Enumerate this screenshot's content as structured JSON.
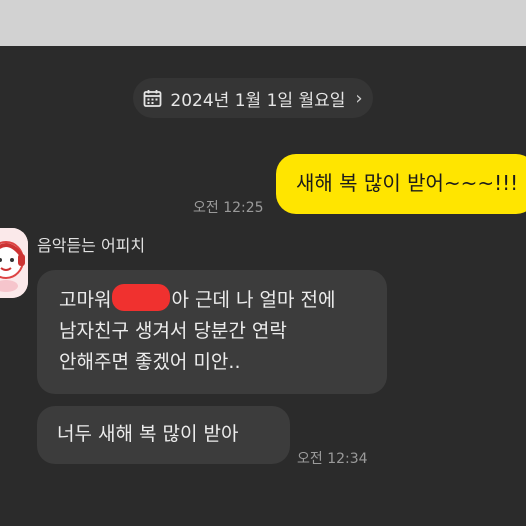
{
  "chat": {
    "date_divider": "2024년 1월 1일 월요일",
    "date_chevron": "›",
    "messages": [
      {
        "side": "me",
        "text": "새해 복 많이 받어~~~!!!",
        "time": "오전 12:25"
      }
    ],
    "incoming": {
      "sender": "음악듣는 어피치",
      "bubble1": {
        "line1_before": "고마워",
        "line1_after": "아 근데 나 얼마 전에",
        "line2": "남자친구 생겨서 당분간 연락",
        "line3": "안해주면 좋겠어 미안.."
      },
      "bubble2": {
        "text": "너두 새해 복 많이 받아",
        "time": "오전 12:34"
      }
    }
  },
  "colors": {
    "background": "#2b2b2b",
    "my_bubble": "#ffe500",
    "their_bubble": "#3c3c3c",
    "redaction": "#f0312f"
  },
  "icons": [
    "calendar-icon",
    "chevron-right-icon",
    "profile-avatar"
  ]
}
